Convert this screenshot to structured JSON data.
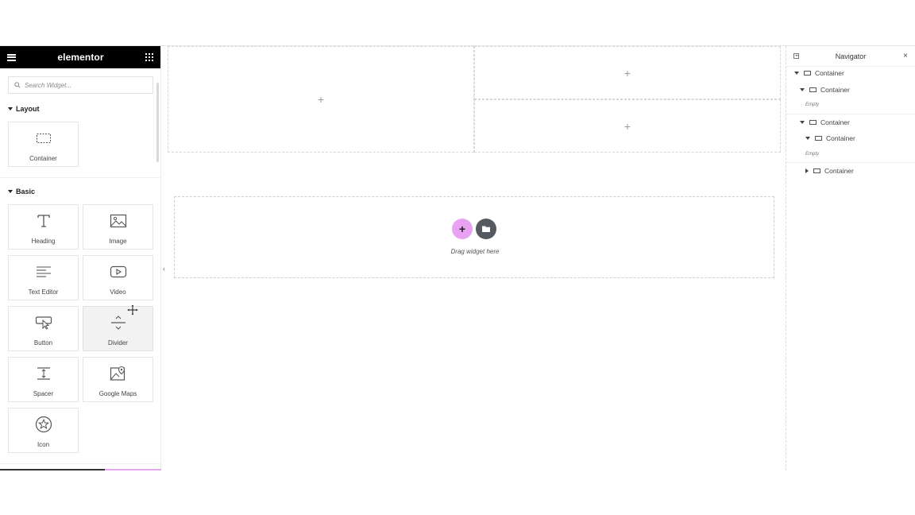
{
  "panel": {
    "brand": "elementor",
    "search_placeholder": "Search Widget...",
    "sections": [
      {
        "title": "Layout",
        "widgets": [
          {
            "label": "Container",
            "icon": "container-icon"
          }
        ]
      },
      {
        "title": "Basic",
        "widgets": [
          {
            "label": "Heading",
            "icon": "heading-icon"
          },
          {
            "label": "Image",
            "icon": "image-icon"
          },
          {
            "label": "Text Editor",
            "icon": "text-editor-icon"
          },
          {
            "label": "Video",
            "icon": "video-icon"
          },
          {
            "label": "Button",
            "icon": "button-icon"
          },
          {
            "label": "Divider",
            "icon": "divider-icon"
          },
          {
            "label": "Spacer",
            "icon": "spacer-icon"
          },
          {
            "label": "Google Maps",
            "icon": "google-maps-icon"
          },
          {
            "label": "Icon",
            "icon": "star-icon"
          }
        ]
      }
    ]
  },
  "canvas": {
    "plus": "+",
    "drag_text": "Drag widget here"
  },
  "navigator": {
    "title": "Navigator",
    "close": "×",
    "items": [
      {
        "label": "Container",
        "expanded": true
      },
      {
        "label": "Container",
        "expanded": true,
        "empty": "Empty"
      },
      {
        "label": "Container",
        "expanded": true
      },
      {
        "label": "Container",
        "expanded": true,
        "empty": "Empty"
      },
      {
        "label": "Container",
        "expanded": false
      }
    ]
  },
  "colors": {
    "header_bg": "#000000",
    "add_button": "#e9a2f2",
    "library_button": "#555a61",
    "footer_progress_pink": "#e4a6ec"
  }
}
